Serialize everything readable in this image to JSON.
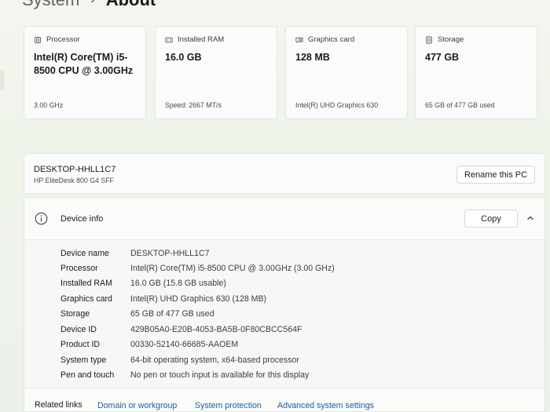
{
  "breadcrumb": {
    "parent": "System",
    "separator": "›",
    "current": "About"
  },
  "cards": [
    {
      "label": "Processor",
      "icon": "processor-icon",
      "value": "Intel(R) Core(TM) i5-8500 CPU @ 3.00GHz",
      "sub": "3.00 GHz"
    },
    {
      "label": "Installed RAM",
      "icon": "ram-icon",
      "value": "16.0 GB",
      "sub": "Speed: 2667 MT/s"
    },
    {
      "label": "Graphics card",
      "icon": "graphics-card-icon",
      "value": "128 MB",
      "sub": "Intel(R) UHD Graphics 630"
    },
    {
      "label": "Storage",
      "icon": "storage-icon",
      "value": "477 GB",
      "sub": "65 GB of 477 GB used"
    }
  ],
  "device": {
    "name": "DESKTOP-HHLL1C7",
    "model": "HP EliteDesk 800 G4 SFF",
    "rename_label": "Rename this PC"
  },
  "device_info": {
    "title": "Device info",
    "copy_label": "Copy",
    "rows": [
      {
        "key": "Device name",
        "value": "DESKTOP-HHLL1C7"
      },
      {
        "key": "Processor",
        "value": "Intel(R) Core(TM) i5-8500 CPU @ 3.00GHz (3.00 GHz)"
      },
      {
        "key": "Installed RAM",
        "value": "16.0 GB (15.8 GB usable)"
      },
      {
        "key": "Graphics card",
        "value": "Intel(R) UHD Graphics 630 (128 MB)"
      },
      {
        "key": "Storage",
        "value": "65 GB of 477 GB used"
      },
      {
        "key": "Device ID",
        "value": "429B05A0-E20B-4053-BA5B-0F80CBCC564F"
      },
      {
        "key": "Product ID",
        "value": "00330-52140-66685-AAOEM"
      },
      {
        "key": "System type",
        "value": "64-bit operating system, x64-based processor"
      },
      {
        "key": "Pen and touch",
        "value": "No pen or touch input is available for this display"
      }
    ]
  },
  "related": {
    "label": "Related links",
    "links": [
      "Domain or workgroup",
      "System protection",
      "Advanced system settings"
    ]
  },
  "colors": {
    "link": "#1f5c9c",
    "card_bg": "#fbfcfa",
    "page_bg": "#eef3ea"
  }
}
